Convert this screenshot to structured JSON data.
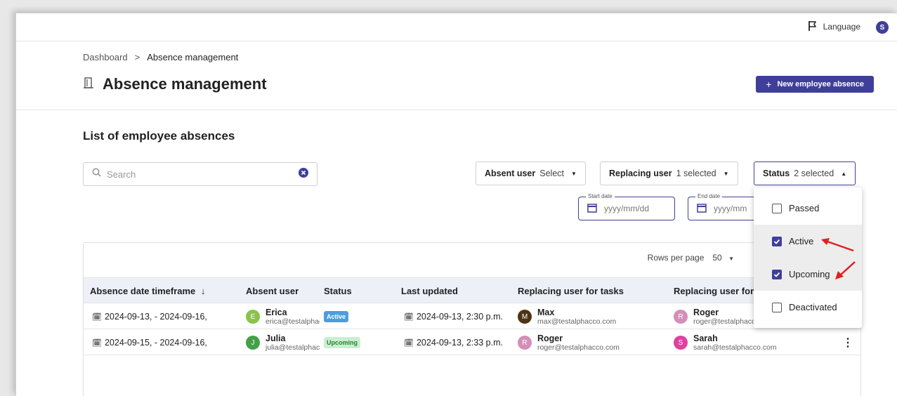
{
  "header": {
    "language_label": "Language",
    "avatar_letter": "S"
  },
  "breadcrumb": {
    "root": "Dashboard",
    "separator": ">",
    "current": "Absence management"
  },
  "page": {
    "title": "Absence management",
    "new_button": "New employee absence",
    "list_title": "List of employee absences"
  },
  "search": {
    "placeholder": "Search"
  },
  "filters": {
    "absent_user": {
      "label": "Absent user",
      "value": "Select"
    },
    "replacing_user": {
      "label": "Replacing user",
      "value": "1 selected"
    },
    "status": {
      "label": "Status",
      "value": "2 selected"
    }
  },
  "dates": {
    "start": {
      "legend": "Start date",
      "placeholder": "yyyy/mm/dd"
    },
    "end": {
      "legend": "End date",
      "placeholder": "yyyy/mm"
    }
  },
  "table": {
    "rows_per_page_label": "Rows per page",
    "rows_per_page_value": "50",
    "columns": [
      "Absence date timeframe",
      "Absent user",
      "Status",
      "Last updated",
      "Replacing user for tasks",
      "Replacing user for"
    ],
    "rows": [
      {
        "timeframe": "2024-09-13, - 2024-09-16,",
        "absent": {
          "letter": "E",
          "name": "Erica",
          "email": "erica@testalphacco.com",
          "color": "#8bc34a"
        },
        "status": "Active",
        "updated": "2024-09-13, 2:30 p.m.",
        "tasks": {
          "letter": "M",
          "name": "Max",
          "email": "max@testalphacco.com",
          "color": "#4e3414"
        },
        "other": {
          "letter": "R",
          "name": "Roger",
          "email": "roger@testalphacco.com",
          "color": "#d38fb8"
        }
      },
      {
        "timeframe": "2024-09-15, - 2024-09-16,",
        "absent": {
          "letter": "J",
          "name": "Julia",
          "email": "julia@testalphacco.com",
          "color": "#43a047"
        },
        "status": "Upcoming",
        "updated": "2024-09-13, 2:33 p.m.",
        "tasks": {
          "letter": "R",
          "name": "Roger",
          "email": "roger@testalphacco.com",
          "color": "#d38fb8"
        },
        "other": {
          "letter": "S",
          "name": "Sarah",
          "email": "sarah@testalphacco.com",
          "color": "#e040a0"
        }
      }
    ]
  },
  "status_options": [
    {
      "label": "Passed",
      "checked": false
    },
    {
      "label": "Active",
      "checked": true
    },
    {
      "label": "Upcoming",
      "checked": true
    },
    {
      "label": "Deactivated",
      "checked": false
    }
  ],
  "colors": {
    "primary": "#3f3f9a",
    "active_badge_bg": "#4a9ee0",
    "upcoming_badge_bg": "#c8f0d0",
    "upcoming_badge_text": "#2e7d32",
    "annotation_arrow": "#e02020"
  }
}
